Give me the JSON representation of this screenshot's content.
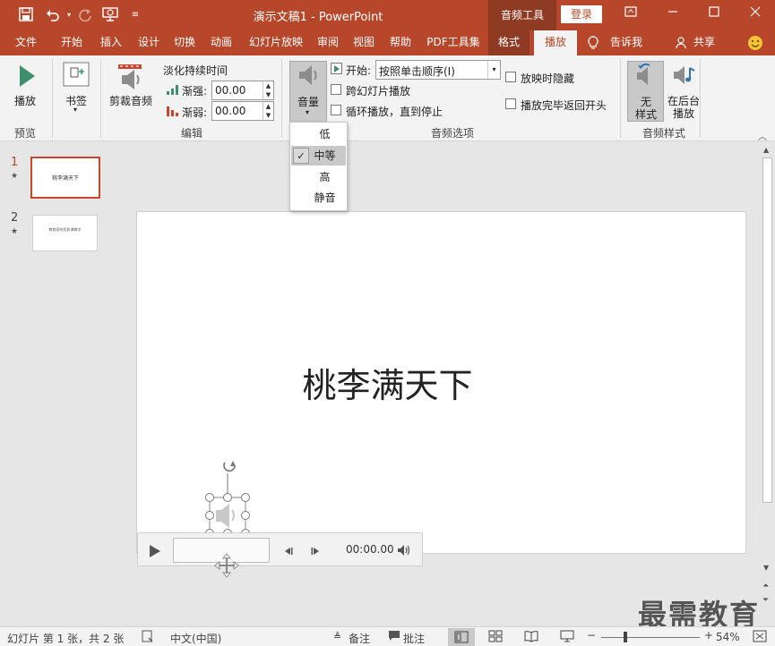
{
  "titlebar": {
    "document_title": "演示文稿1  -  PowerPoint",
    "context_tools": "音频工具",
    "login": "登录",
    "icons": [
      "save-icon",
      "undo-icon",
      "redo-icon",
      "present-icon",
      "customize-icon",
      "ribbon-display-icon",
      "minimize-icon",
      "maximize-icon",
      "close-icon"
    ]
  },
  "menu": {
    "items": [
      "文件",
      "开始",
      "插入",
      "设计",
      "切换",
      "动画",
      "幻灯片放映",
      "审阅",
      "视图",
      "帮助",
      "PDF工具集",
      "格式",
      "播放"
    ],
    "tell_me": "告诉我",
    "share": "共享"
  },
  "ribbon": {
    "preview": {
      "button": "播放",
      "group": "预览"
    },
    "bookmarks": {
      "button": "书签"
    },
    "editing": {
      "trim": "剪裁音频",
      "fade_duration": "淡化持续时间",
      "fade_in_label": "渐强:",
      "fade_in_value": "00.00",
      "fade_out_label": "渐弱:",
      "fade_out_value": "00.00",
      "group": "编辑"
    },
    "audio_options": {
      "volume": "音量",
      "start_label": "开始:",
      "start_value": "按照单击顺序(I)",
      "play_across": "跨幻灯片播放",
      "loop": "循环播放，直到停止",
      "hide": "放映时隐藏",
      "rewind": "播放完毕返回开头",
      "group": "音频选项"
    },
    "audio_styles": {
      "no_style": "无\n样式",
      "no_style_l1": "无",
      "no_style_l2": "样式",
      "bg_play_l1": "在后台",
      "bg_play_l2": "播放",
      "group": "音频样式"
    }
  },
  "volume_menu": {
    "items": [
      "低",
      "中等",
      "高",
      "静音"
    ],
    "selected": "中等"
  },
  "slides": {
    "thumbs": [
      {
        "number": "1",
        "star": "★",
        "text": "桃李满天下"
      },
      {
        "number": "2",
        "star": "★",
        "text": "教育家的优质课教学"
      }
    ]
  },
  "slide": {
    "title": "桃李满天下"
  },
  "player": {
    "time": "00:00.00"
  },
  "statusbar": {
    "slide_info": "幻灯片 第 1 张，共 2 张",
    "language": "中文(中国)",
    "notes": "备注",
    "comments": "批注",
    "zoom": "54%"
  },
  "watermark": "最需教育",
  "colors": {
    "accent": "#b7472a",
    "accent_dark": "#8f3a22",
    "ribbon": "#f3f3f3"
  }
}
